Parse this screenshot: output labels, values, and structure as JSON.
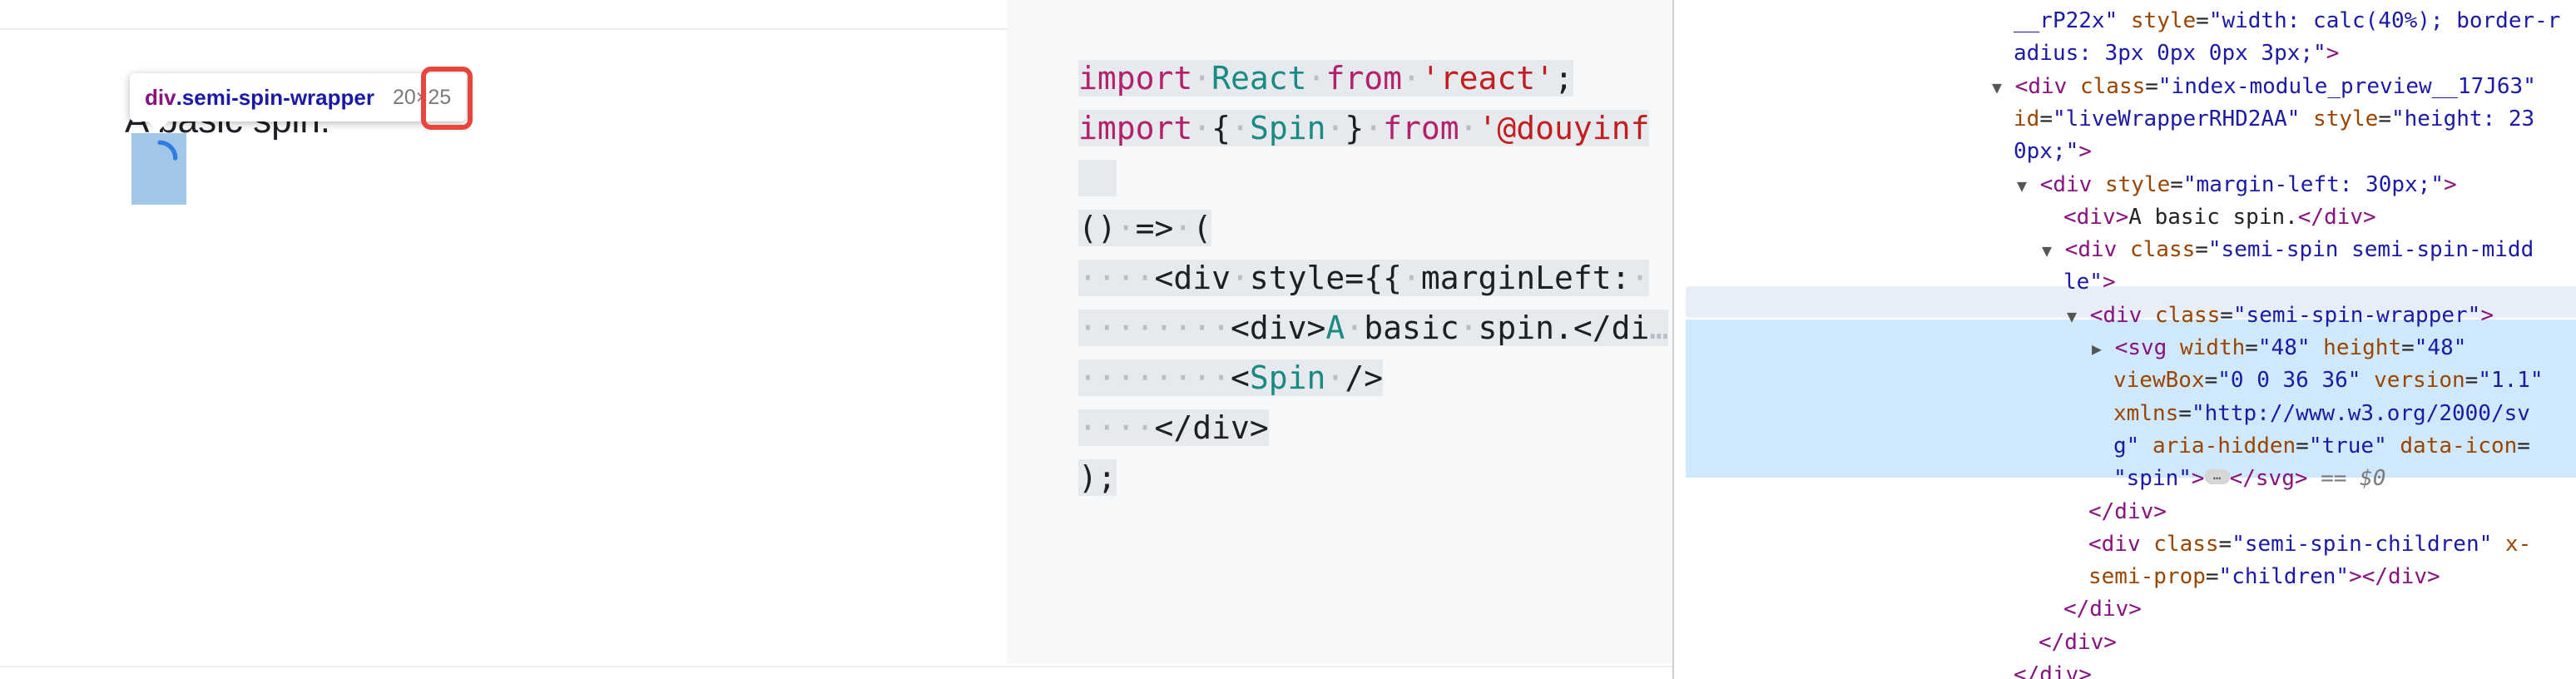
{
  "preview": {
    "caption": "A basic spin.",
    "inspect_tooltip": {
      "tag": "div",
      "class_name": ".semi-spin-wrapper",
      "dims": "20×25"
    }
  },
  "code": {
    "lines": [
      {
        "parts": [
          [
            "k",
            "import"
          ],
          [
            "d",
            "·"
          ],
          [
            "t",
            "React"
          ],
          [
            "d",
            "·"
          ],
          [
            "k",
            "from"
          ],
          [
            "d",
            "·"
          ],
          [
            "s",
            "'react'"
          ],
          [
            "p",
            ";"
          ]
        ]
      },
      {
        "parts": [
          [
            "k",
            "import"
          ],
          [
            "d",
            "·"
          ],
          [
            "p",
            "{"
          ],
          [
            "d",
            "·"
          ],
          [
            "t",
            "Spin"
          ],
          [
            "d",
            "·"
          ],
          [
            "p",
            "}"
          ],
          [
            "d",
            "·"
          ],
          [
            "k",
            "from"
          ],
          [
            "d",
            "·"
          ],
          [
            "s",
            "'@douyinf"
          ]
        ]
      },
      {
        "parts": [
          [
            "p",
            "  "
          ]
        ]
      },
      {
        "parts": [
          [
            "p",
            "()"
          ],
          [
            "d",
            "·"
          ],
          [
            "p",
            "=>"
          ],
          [
            "d",
            "·"
          ],
          [
            "p",
            "("
          ]
        ]
      },
      {
        "parts": [
          [
            "d",
            "····"
          ],
          [
            "p",
            "<div"
          ],
          [
            "d",
            "·"
          ],
          [
            "p",
            "style={{"
          ],
          [
            "d",
            "·"
          ],
          [
            "p",
            "marginLeft:"
          ],
          [
            "d",
            "·"
          ]
        ]
      },
      {
        "parts": [
          [
            "d",
            "········"
          ],
          [
            "p",
            "<div>"
          ],
          [
            "t",
            "A"
          ],
          [
            "d",
            "·"
          ],
          [
            "p",
            "basic"
          ],
          [
            "d",
            "·"
          ],
          [
            "p",
            "spin.</di"
          ],
          [
            "d",
            "…"
          ]
        ]
      },
      {
        "parts": [
          [
            "d",
            "········"
          ],
          [
            "p",
            "<"
          ],
          [
            "t",
            "Spin"
          ],
          [
            "d",
            "·"
          ],
          [
            "p",
            "/>"
          ]
        ]
      },
      {
        "parts": [
          [
            "d",
            "····"
          ],
          [
            "p",
            "</div>"
          ]
        ]
      },
      {
        "parts": [
          [
            "p",
            ");"
          ]
        ]
      }
    ]
  },
  "devtools": {
    "rows": [
      {
        "indent": 0,
        "tri": "",
        "parts": [
          [
            "av",
            "__rP22x\""
          ],
          [
            "an",
            " style"
          ],
          [
            "tx",
            "="
          ],
          [
            "av",
            "\"width: calc(40%); border-r"
          ]
        ]
      },
      {
        "indent": 0,
        "tri": "",
        "parts": [
          [
            "av",
            "adius: 3px 0px 0px 3px;\""
          ],
          [
            "tg",
            ">"
          ]
        ]
      },
      {
        "indent": 0,
        "tri": "▼",
        "parts": [
          [
            "tg",
            "<div"
          ],
          [
            "an",
            " class"
          ],
          [
            "tx",
            "="
          ],
          [
            "av",
            "\"index-module_preview__17J63\""
          ]
        ]
      },
      {
        "indent": 0,
        "tri": "",
        "parts": [
          [
            "an",
            "id"
          ],
          [
            "tx",
            "="
          ],
          [
            "av",
            "\"liveWrapperRHD2AA\""
          ],
          [
            "an",
            " style"
          ],
          [
            "tx",
            "="
          ],
          [
            "av",
            "\"height: 23"
          ]
        ]
      },
      {
        "indent": 0,
        "tri": "",
        "parts": [
          [
            "av",
            "0px;\""
          ],
          [
            "tg",
            ">"
          ]
        ]
      },
      {
        "indent": 1,
        "tri": "▼",
        "parts": [
          [
            "tg",
            "<div"
          ],
          [
            "an",
            " style"
          ],
          [
            "tx",
            "="
          ],
          [
            "av",
            "\"margin-left: 30px;\""
          ],
          [
            "tg",
            ">"
          ]
        ]
      },
      {
        "indent": 2,
        "tri": "",
        "parts": [
          [
            "tg",
            "<div>"
          ],
          [
            "tx",
            "A basic spin."
          ],
          [
            "tg",
            "</div>"
          ]
        ]
      },
      {
        "indent": 2,
        "tri": "▼",
        "parts": [
          [
            "tg",
            "<div"
          ],
          [
            "an",
            " class"
          ],
          [
            "tx",
            "="
          ],
          [
            "av",
            "\"semi-spin semi-spin-midd"
          ]
        ]
      },
      {
        "indent": 2,
        "tri": "",
        "parts": [
          [
            "av",
            "le\""
          ],
          [
            "tg",
            ">"
          ]
        ]
      },
      {
        "indent": 3,
        "tri": "▼",
        "parts": [
          [
            "tg",
            "<div"
          ],
          [
            "an",
            " class"
          ],
          [
            "tx",
            "="
          ],
          [
            "av",
            "\"semi-spin-wrapper\""
          ],
          [
            "tg",
            ">"
          ]
        ]
      },
      {
        "indent": 4,
        "tri": "▶",
        "parts": [
          [
            "tg",
            "<svg"
          ],
          [
            "an",
            " width"
          ],
          [
            "tx",
            "="
          ],
          [
            "av",
            "\"48\""
          ],
          [
            "an",
            " height"
          ],
          [
            "tx",
            "="
          ],
          [
            "av",
            "\"48\""
          ]
        ]
      },
      {
        "indent": 4,
        "tri": "",
        "parts": [
          [
            "an",
            "viewBox"
          ],
          [
            "tx",
            "="
          ],
          [
            "av",
            "\"0 0 36 36\""
          ],
          [
            "an",
            " version"
          ],
          [
            "tx",
            "="
          ],
          [
            "av",
            "\"1.1\""
          ]
        ]
      },
      {
        "indent": 4,
        "tri": "",
        "parts": [
          [
            "an",
            "xmlns"
          ],
          [
            "tx",
            "="
          ],
          [
            "av",
            "\"http://www.w3.org/2000/sv"
          ]
        ]
      },
      {
        "indent": 4,
        "tri": "",
        "parts": [
          [
            "av",
            "g\""
          ],
          [
            "an",
            " aria-hidden"
          ],
          [
            "tx",
            "="
          ],
          [
            "av",
            "\"true\""
          ],
          [
            "an",
            " data-icon"
          ],
          [
            "tx",
            "="
          ]
        ]
      },
      {
        "indent": 4,
        "tri": "",
        "parts": [
          [
            "av",
            "\"spin\""
          ],
          [
            "tg",
            ">"
          ],
          [
            "dots",
            "…"
          ],
          [
            "tg",
            "</svg>"
          ],
          [
            "ev",
            " == $0"
          ]
        ]
      },
      {
        "indent": 3,
        "tri": "",
        "parts": [
          [
            "tg",
            "</div>"
          ]
        ]
      },
      {
        "indent": 3,
        "tri": "",
        "parts": [
          [
            "tg",
            "<div"
          ],
          [
            "an",
            " class"
          ],
          [
            "tx",
            "="
          ],
          [
            "av",
            "\"semi-spin-children\""
          ],
          [
            "an",
            " x-"
          ]
        ]
      },
      {
        "indent": 3,
        "tri": "",
        "parts": [
          [
            "an",
            "semi-prop"
          ],
          [
            "tx",
            "="
          ],
          [
            "av",
            "\"children\""
          ],
          [
            "tg",
            "></div>"
          ]
        ]
      },
      {
        "indent": 2,
        "tri": "",
        "parts": [
          [
            "tg",
            "</div>"
          ]
        ]
      },
      {
        "indent": 1,
        "tri": "",
        "parts": [
          [
            "tg",
            "</div>"
          ]
        ]
      },
      {
        "indent": 0,
        "tri": "",
        "parts": [
          [
            "tg",
            "</div>"
          ]
        ]
      }
    ]
  },
  "colors": {
    "highlight": "#6fa8dc",
    "red_box": "#e8453c",
    "spinner": "#2f7de1",
    "selected_row": "#cfe8fc"
  }
}
